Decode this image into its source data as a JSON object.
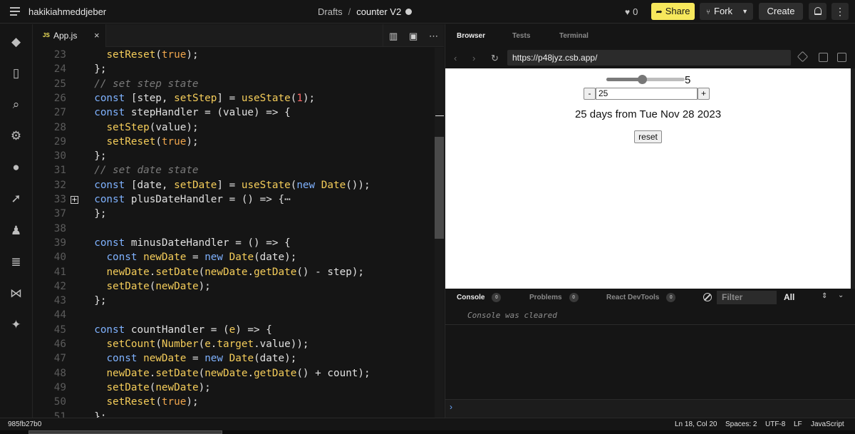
{
  "topbar": {
    "username": "hakikiahmeddjeber",
    "breadcrumb_root": "Drafts",
    "breadcrumb_sep": "/",
    "project_name": "counter V2",
    "likes": "0",
    "share_label": "Share",
    "fork_label": "Fork",
    "create_label": "Create",
    "more_label": "⋮"
  },
  "editor": {
    "tab_icon": "JS",
    "tab_name": "App.js",
    "tab_close": "×",
    "lines": [
      {
        "num": "23",
        "code": "    setReset(true);"
      },
      {
        "num": "24",
        "code": "  };"
      },
      {
        "num": "25",
        "code": "  // set step state"
      },
      {
        "num": "26",
        "code": "  const [step, setStep] = useState(1);"
      },
      {
        "num": "27",
        "code": "  const stepHandler = (value) => {"
      },
      {
        "num": "28",
        "code": "    setStep(value);"
      },
      {
        "num": "29",
        "code": "    setReset(true);"
      },
      {
        "num": "30",
        "code": "  };"
      },
      {
        "num": "31",
        "code": "  // set date state"
      },
      {
        "num": "32",
        "code": "  const [date, setDate] = useState(new Date());"
      },
      {
        "num": "33",
        "code": "  const plusDateHandler = () => {⋯"
      },
      {
        "num": "37",
        "code": "  };"
      },
      {
        "num": "38",
        "code": ""
      },
      {
        "num": "39",
        "code": "  const minusDateHandler = () => {"
      },
      {
        "num": "40",
        "code": "    const newDate = new Date(date);"
      },
      {
        "num": "41",
        "code": "    newDate.setDate(newDate.getDate() - step);"
      },
      {
        "num": "42",
        "code": "    setDate(newDate);"
      },
      {
        "num": "43",
        "code": "  };"
      },
      {
        "num": "44",
        "code": ""
      },
      {
        "num": "45",
        "code": "  const countHandler = (e) => {"
      },
      {
        "num": "46",
        "code": "    setCount(Number(e.target.value));"
      },
      {
        "num": "47",
        "code": "    const newDate = new Date(date);"
      },
      {
        "num": "48",
        "code": "    newDate.setDate(newDate.getDate() + count);"
      },
      {
        "num": "49",
        "code": "    setDate(newDate);"
      },
      {
        "num": "50",
        "code": "    setReset(true);"
      },
      {
        "num": "51",
        "code": "  };"
      }
    ]
  },
  "preview": {
    "tabs": [
      "Browser",
      "Tests",
      "Terminal"
    ],
    "url": "https://p48jyz.csb.app/",
    "app": {
      "slider_value": "5",
      "slider_fraction": 0.45,
      "minus_label": "-",
      "plus_label": "+",
      "count_value": "25",
      "result_text": "25 days from Tue Nov 28 2023",
      "reset_label": "reset"
    },
    "console": {
      "tabs": [
        {
          "label": "Console",
          "count": "0"
        },
        {
          "label": "Problems",
          "count": "0"
        },
        {
          "label": "React DevTools",
          "count": "0"
        }
      ],
      "filter_placeholder": "Filter",
      "level": "All",
      "message": "Console was cleared",
      "prompt": "›"
    }
  },
  "statusbar": {
    "commit": "985fb27b0",
    "position": "Ln 18, Col 20",
    "spaces": "Spaces: 2",
    "encoding": "UTF-8",
    "eol": "LF",
    "language": "JavaScript"
  }
}
